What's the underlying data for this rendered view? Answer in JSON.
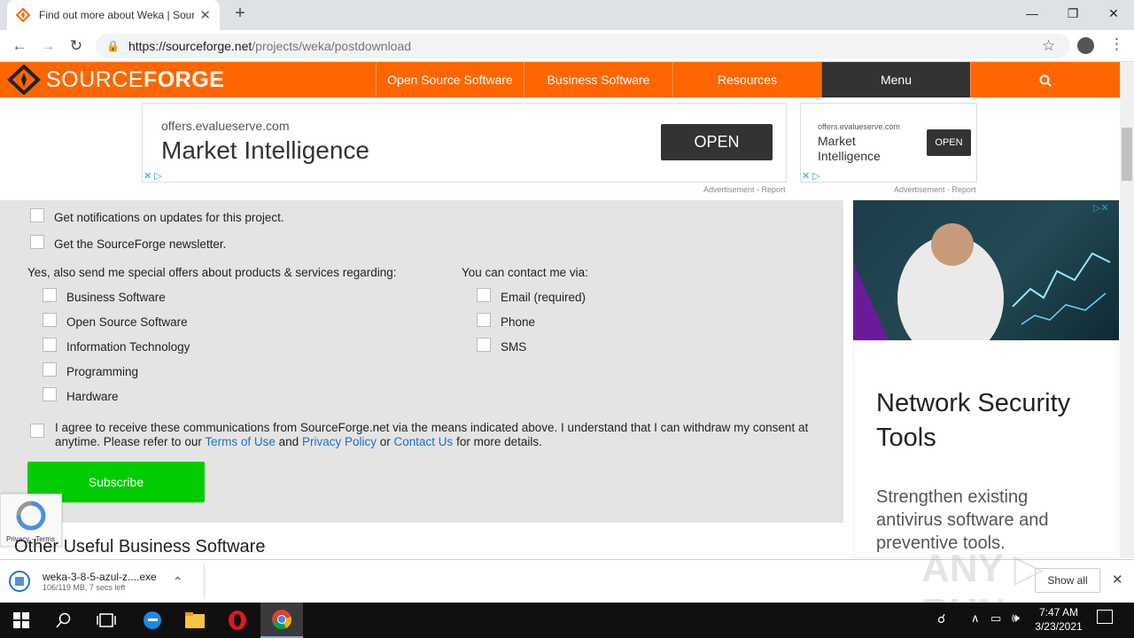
{
  "browser": {
    "tab_title": "Find out more about Weka | Sour",
    "url_host": "https://sourceforge.net",
    "url_path": "/projects/weka/postdownload",
    "window_controls": [
      "—",
      "❐",
      "✕"
    ]
  },
  "site": {
    "logo_light": "SOURCE",
    "logo_bold": "FORGE",
    "nav": [
      "Open Source Software",
      "Business Software",
      "Resources",
      "Menu"
    ],
    "brand_color": "#ff6600"
  },
  "ads": {
    "top1": {
      "domain": "offers.evalueserve.com",
      "headline": "Market Intelligence",
      "button": "OPEN",
      "label": "Advertisement - Report"
    },
    "top2": {
      "domain": "offers.evalueserve.com",
      "headline": "Market Intelligence",
      "button": "OPEN",
      "label": "Advertisement - Report"
    },
    "right": {
      "title": "Network Security Tools",
      "body": "Strengthen existing antivirus software and preventive tools."
    }
  },
  "form": {
    "notify_label": "Get notifications on updates for this project.",
    "newsletter_label": "Get the SourceForge newsletter.",
    "offers_heading": "Yes, also send me special offers about products & services regarding:",
    "offer_options": [
      "Business Software",
      "Open Source Software",
      "Information Technology",
      "Programming",
      "Hardware"
    ],
    "contact_heading": "You can contact me via:",
    "contact_options": [
      "Email (required)",
      "Phone",
      "SMS"
    ],
    "consent_text_1": "I agree to receive these communications from SourceForge.net via the means indicated above. I understand that I can withdraw my consent at anytime. Please refer to our",
    "terms_link": "Terms of Use",
    "and_text": "and",
    "privacy_link": "Privacy Policy",
    "or_text": "or",
    "contact_link": "Contact Us",
    "consent_text_2": "for more details.",
    "subscribe_label": "Subscribe",
    "recaptcha_text": "Privacy - Terms"
  },
  "section_heading": "Other Useful Business Software",
  "download": {
    "filename": "weka-3-8-5-azul-z....exe",
    "progress_text": "106/119 MB, 7 secs left",
    "show_all": "Show all"
  },
  "taskbar": {
    "time": "7:47 AM",
    "date": "3/23/2021"
  }
}
